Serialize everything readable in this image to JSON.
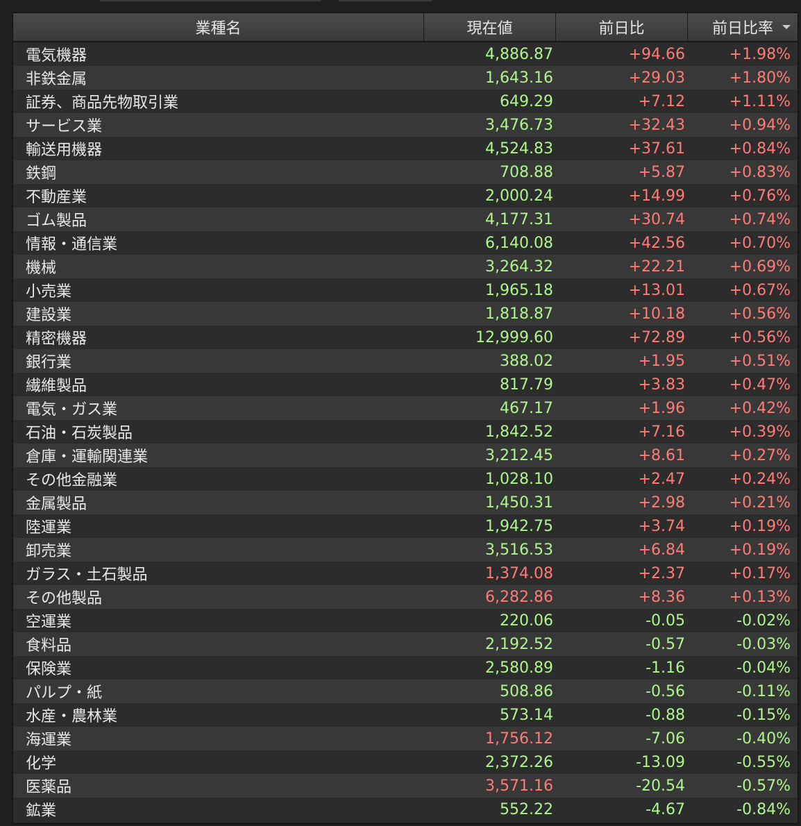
{
  "headers": {
    "name": "業種名",
    "value": "現在値",
    "change": "前日比",
    "change_pct": "前日比率"
  },
  "colors": {
    "up": "#ff7b76",
    "down": "#aef58c"
  },
  "rows": [
    {
      "name": "電気機器",
      "value": "4,886.87",
      "value_color": "green",
      "change": "+94.66",
      "pct": "+1.98%",
      "dir": "up"
    },
    {
      "name": "非鉄金属",
      "value": "1,643.16",
      "value_color": "green",
      "change": "+29.03",
      "pct": "+1.80%",
      "dir": "up"
    },
    {
      "name": "証券、商品先物取引業",
      "value": "649.29",
      "value_color": "green",
      "change": "+7.12",
      "pct": "+1.11%",
      "dir": "up"
    },
    {
      "name": "サービス業",
      "value": "3,476.73",
      "value_color": "green",
      "change": "+32.43",
      "pct": "+0.94%",
      "dir": "up"
    },
    {
      "name": "輸送用機器",
      "value": "4,524.83",
      "value_color": "green",
      "change": "+37.61",
      "pct": "+0.84%",
      "dir": "up"
    },
    {
      "name": "鉄鋼",
      "value": "708.88",
      "value_color": "green",
      "change": "+5.87",
      "pct": "+0.83%",
      "dir": "up"
    },
    {
      "name": "不動産業",
      "value": "2,000.24",
      "value_color": "green",
      "change": "+14.99",
      "pct": "+0.76%",
      "dir": "up"
    },
    {
      "name": "ゴム製品",
      "value": "4,177.31",
      "value_color": "green",
      "change": "+30.74",
      "pct": "+0.74%",
      "dir": "up"
    },
    {
      "name": "情報・通信業",
      "value": "6,140.08",
      "value_color": "green",
      "change": "+42.56",
      "pct": "+0.70%",
      "dir": "up"
    },
    {
      "name": "機械",
      "value": "3,264.32",
      "value_color": "green",
      "change": "+22.21",
      "pct": "+0.69%",
      "dir": "up"
    },
    {
      "name": "小売業",
      "value": "1,965.18",
      "value_color": "green",
      "change": "+13.01",
      "pct": "+0.67%",
      "dir": "up"
    },
    {
      "name": "建設業",
      "value": "1,818.87",
      "value_color": "green",
      "change": "+10.18",
      "pct": "+0.56%",
      "dir": "up"
    },
    {
      "name": "精密機器",
      "value": "12,999.60",
      "value_color": "green",
      "change": "+72.89",
      "pct": "+0.56%",
      "dir": "up"
    },
    {
      "name": "銀行業",
      "value": "388.02",
      "value_color": "green",
      "change": "+1.95",
      "pct": "+0.51%",
      "dir": "up"
    },
    {
      "name": "繊維製品",
      "value": "817.79",
      "value_color": "green",
      "change": "+3.83",
      "pct": "+0.47%",
      "dir": "up"
    },
    {
      "name": "電気・ガス業",
      "value": "467.17",
      "value_color": "green",
      "change": "+1.96",
      "pct": "+0.42%",
      "dir": "up"
    },
    {
      "name": "石油・石炭製品",
      "value": "1,842.52",
      "value_color": "green",
      "change": "+7.16",
      "pct": "+0.39%",
      "dir": "up"
    },
    {
      "name": "倉庫・運輸関連業",
      "value": "3,212.45",
      "value_color": "green",
      "change": "+8.61",
      "pct": "+0.27%",
      "dir": "up"
    },
    {
      "name": "その他金融業",
      "value": "1,028.10",
      "value_color": "green",
      "change": "+2.47",
      "pct": "+0.24%",
      "dir": "up"
    },
    {
      "name": "金属製品",
      "value": "1,450.31",
      "value_color": "green",
      "change": "+2.98",
      "pct": "+0.21%",
      "dir": "up"
    },
    {
      "name": "陸運業",
      "value": "1,942.75",
      "value_color": "green",
      "change": "+3.74",
      "pct": "+0.19%",
      "dir": "up"
    },
    {
      "name": "卸売業",
      "value": "3,516.53",
      "value_color": "green",
      "change": "+6.84",
      "pct": "+0.19%",
      "dir": "up"
    },
    {
      "name": "ガラス・土石製品",
      "value": "1,374.08",
      "value_color": "red",
      "change": "+2.37",
      "pct": "+0.17%",
      "dir": "up"
    },
    {
      "name": "その他製品",
      "value": "6,282.86",
      "value_color": "red",
      "change": "+8.36",
      "pct": "+0.13%",
      "dir": "up"
    },
    {
      "name": "空運業",
      "value": "220.06",
      "value_color": "green",
      "change": "-0.05",
      "pct": "-0.02%",
      "dir": "down"
    },
    {
      "name": "食料品",
      "value": "2,192.52",
      "value_color": "green",
      "change": "-0.57",
      "pct": "-0.03%",
      "dir": "down"
    },
    {
      "name": "保険業",
      "value": "2,580.89",
      "value_color": "green",
      "change": "-1.16",
      "pct": "-0.04%",
      "dir": "down"
    },
    {
      "name": "パルプ・紙",
      "value": "508.86",
      "value_color": "green",
      "change": "-0.56",
      "pct": "-0.11%",
      "dir": "down"
    },
    {
      "name": "水産・農林業",
      "value": "573.14",
      "value_color": "green",
      "change": "-0.88",
      "pct": "-0.15%",
      "dir": "down"
    },
    {
      "name": "海運業",
      "value": "1,756.12",
      "value_color": "red",
      "change": "-7.06",
      "pct": "-0.40%",
      "dir": "down"
    },
    {
      "name": "化学",
      "value": "2,372.26",
      "value_color": "green",
      "change": "-13.09",
      "pct": "-0.55%",
      "dir": "down"
    },
    {
      "name": "医薬品",
      "value": "3,571.16",
      "value_color": "red",
      "change": "-20.54",
      "pct": "-0.57%",
      "dir": "down"
    },
    {
      "name": "鉱業",
      "value": "552.22",
      "value_color": "green",
      "change": "-4.67",
      "pct": "-0.84%",
      "dir": "down"
    }
  ]
}
